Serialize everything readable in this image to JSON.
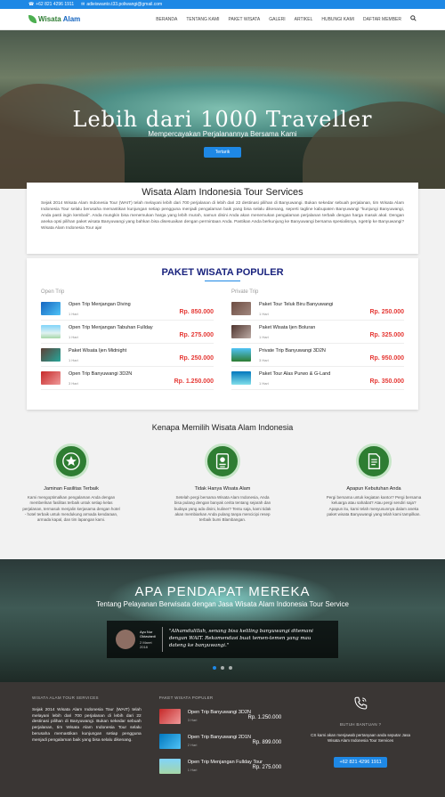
{
  "topbar": {
    "phone": "+62 821 4296 1911",
    "email": "adieiswanto.t33.poliwangi@gmail.com"
  },
  "brand": {
    "name_part1": "Wisata",
    "name_part2": "Alam"
  },
  "nav": {
    "items": [
      "BERANDA",
      "TENTANG KAMI",
      "PAKET WISATA",
      "GALERI",
      "ARTIKEL",
      "HUBUNGI KAMI",
      "DAFTAR MEMBER"
    ]
  },
  "hero": {
    "title": "Lebih dari 1000 Traveller",
    "subtitle": "Mempercayakan Perjalanannya Bersama Kami",
    "button": "Tertarik"
  },
  "intro": {
    "title": "Wisata Alam Indonesia Tour Services",
    "text": "Sejak 2014 Wisata Alam Indonesia Tour (WAIT) telah melayani lebih dari 700 perjalanan di lebih dari 22 destinasi pilihan di Banyuwangi. Bukan sekedar sebuah perjalanan, tim Wisata Alam Indonesia Tour selalu berusaha memastikan kunjungan setiap pengguna menjadi pengalaman baik yang bisa selalu dikenang, seperti tagline kabupaten Banyuwangi \"kunjungi Banyuwangi, Anda pasti ingin kembali\". Anda mungkin bisa menemukan harga yang lebih murah, namun disini Anda akan menemukan pengalaman perjalanan terbaik dengan harga masuk akal. Dengan aneka opsi pilihan paket wisata Banyuwangi yang bahkan bisa disesuaikan dengan permintaan Anda. Pastikan Anda berkunjung ke Banyuwangi bersama spesialisnya, ngetrip ke Banyuwangi? Wisata Alam Indonesia Tour aja!"
  },
  "paket": {
    "title": "PAKET WISATA POPULER",
    "open": {
      "label": "Open Trip",
      "items": [
        {
          "name": "Open Trip Menjangan Diving",
          "dur": "1 Hari",
          "price": "Rp. 850.000"
        },
        {
          "name": "Open Trip Menjangan Tabuhan Fullday",
          "dur": "1 Hari",
          "price": "Rp. 275.000"
        },
        {
          "name": "Paket Wisata Ijen Midnight",
          "dur": "1 Hari",
          "price": "Rp. 250.000"
        },
        {
          "name": "Open Trip Banyuwangi 3D2N",
          "dur": "3 Hari",
          "price": "Rp. 1.250.000"
        }
      ]
    },
    "private": {
      "label": "Private Trip",
      "items": [
        {
          "name": "Paket Tour Teluk Biru Banyuwangi",
          "dur": "1 Hari",
          "price": "Rp. 250.000"
        },
        {
          "name": "Paket Wisata Ijen Boluran",
          "dur": "1 Hari",
          "price": "Rp. 325.000"
        },
        {
          "name": "Private Trip Banyuwangi 3D2N",
          "dur": "3 Hari",
          "price": "Rp. 950.000"
        },
        {
          "name": "Paket Tour Alas Purwo & G-Land",
          "dur": "1 Hari",
          "price": "Rp. 350.000"
        }
      ]
    }
  },
  "why": {
    "title": "Kenapa Memilih Wisata Alam Indonesia",
    "features": [
      {
        "title": "Jaminan Fasilitas Terbaik",
        "text": "Kami mengoptimalkan pengalaman Anda dengan memberikan fasilitas terbaik untuk setiap kelas perjalanan, termasuk menjalin kerjasama dengan hotel - hotel terbaik untuk mendukung armada kendaraan, armada kapal, dan tim lapangan kami."
      },
      {
        "title": "Tidak Hanya Wisata Alam",
        "text": "Setelah pergi bersama Wisata Alam Indonesia, Anda bisa pulang dengan banyak cerita tentang sejarah dan budaya yang ada disini, kuliner? Tentu saja, kami tidak akan membiarkan Anda pulang tanpa mencicipi resep terbaik bumi Blambangan."
      },
      {
        "title": "Apapun Kebutuhan Anda",
        "text": "Pergi bersama untuk kegiatan kantor? Pergi bersama keluarga atau sahabat? Atau pergi sendiri saja? Apapun itu, kami telah menyusunnya dalam aneka paket wisata Banyuwangi yang telah kami tampilkan."
      }
    ]
  },
  "testimonial": {
    "title": "APA PENDAPAT MEREKA",
    "subtitle": "Tentang Pelayanan Berwisata dengan Jasa Wisata Alam Indonesia Tour Service",
    "name": "Ayu Nur Oktavianti",
    "date": "2 Maret 2018",
    "quote": "\"Alhamdulillah, senang bisa keliling banyuwangi ditemani dengan WAIT. Rekomendasi buat temen-temen yang mau dateng ke banyuwangi.\""
  },
  "footer": {
    "about_title": "WISATA ALAM TOUR SERVICES",
    "about_text": "Sejak 2014 Wisata Alam Indonesia Tour (WAIT) telah melayani lebih dari 700 perjalanan di lebih dari 22 destinasi pilihan di Banyuwangi. Bukan sekedar sebuah perjalanan, tim Wisata Alam Indonesia Tour selalu berusaha memastikan kunjungan setiap pengguna menjadi pengalaman baik yang bisa selalu dikenang.",
    "paket_title": "PAKET WISATA POPULER",
    "paket": [
      {
        "name": "Open Trip Banyuwangi 3D2N",
        "dur": "3 Hari",
        "price": "Rp. 1.250.000"
      },
      {
        "name": "Open Trip Banyuwangi 2D1N",
        "dur": "2 Hari",
        "price": "Rp. 899.000"
      },
      {
        "name": "Open Trip Menjangan Fullday Tour",
        "dur": "1 Hari",
        "price": "Rp. 275.000"
      }
    ],
    "help_title": "BUTUH BANTUAN ?",
    "help_text": "CS kami akan menjawab pertanyaan anda seputar Jasa Wisata Alam Indonesia Tour Services",
    "phone": "+62 821 4296 1911"
  }
}
